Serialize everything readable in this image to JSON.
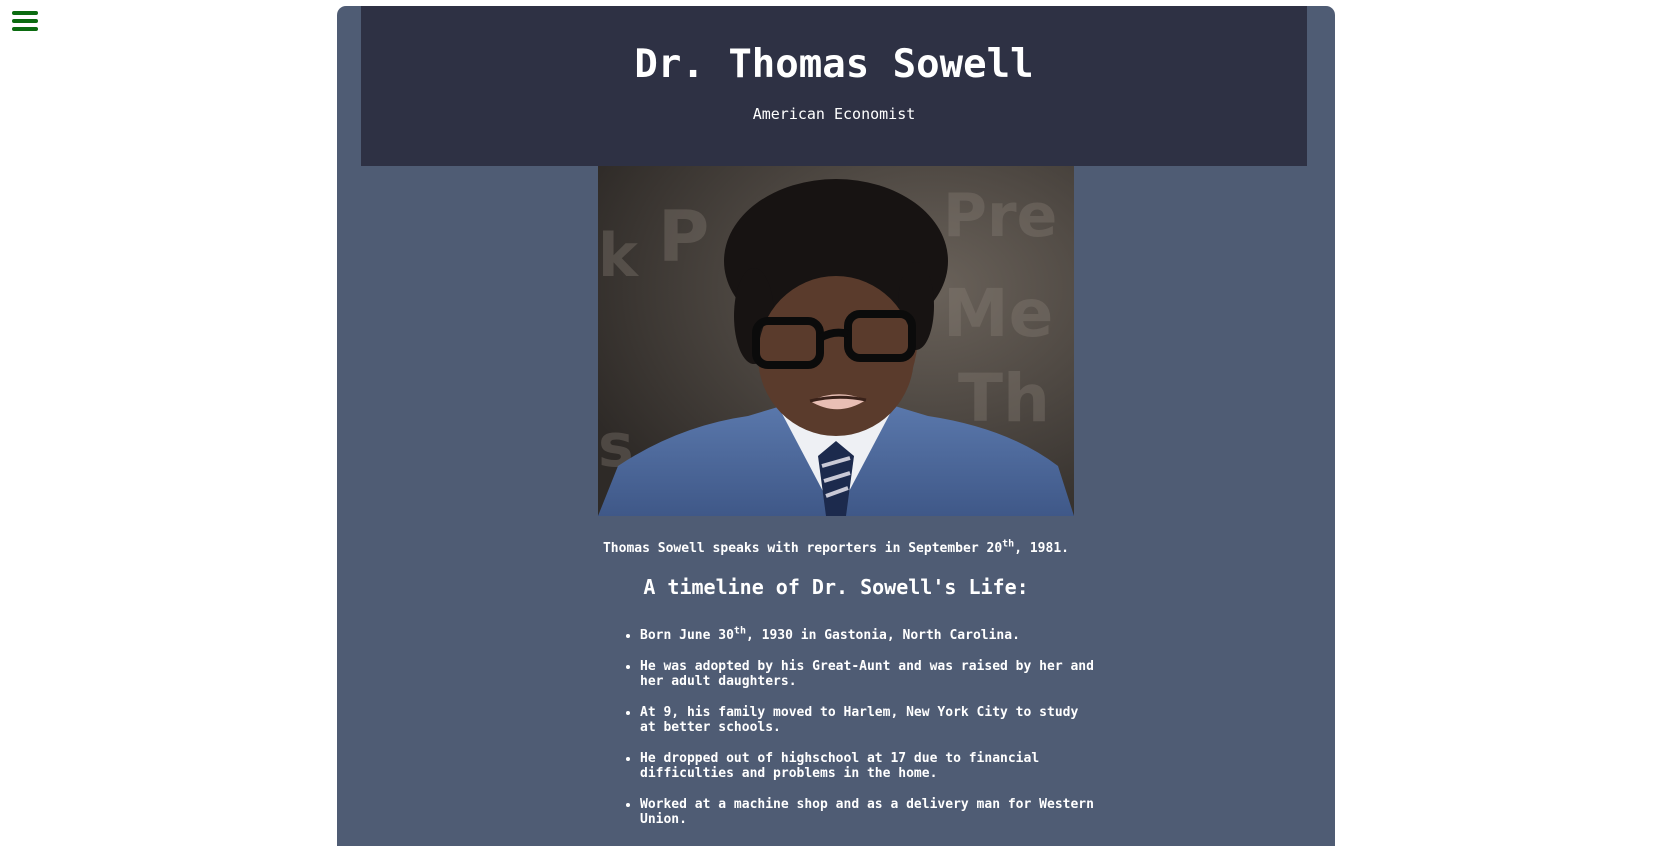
{
  "nav": {
    "menu_icon": "hamburger-menu-icon",
    "accent": "#0b6b10"
  },
  "header": {
    "title": "Dr. Thomas Sowell",
    "subtitle": "American Economist"
  },
  "photo": {
    "alt": "Thomas Sowell portrait"
  },
  "caption": {
    "before": "Thomas Sowell speaks with reporters in September 20",
    "sup": "th",
    "after": ", 1981."
  },
  "timeline": {
    "heading": "A timeline of Dr. Sowell's Life:",
    "items": [
      {
        "before": "Born June 30",
        "sup": "th",
        "after": ", 1930 in Gastonia, North Carolina."
      },
      {
        "text": "He was adopted by his Great-Aunt and was raised by her and her adult daughters."
      },
      {
        "text": "At 9, his family moved to Harlem, New York City to study at better schools."
      },
      {
        "text": "He dropped out of highschool at 17 due to financial difficulties and problems in the home."
      },
      {
        "text": "Worked at a machine shop and as a delivery man for Western Union."
      }
    ]
  },
  "colors": {
    "page": "#ffffff",
    "container": "#4f5c74",
    "header": "#2e3144",
    "text": "#ffffff"
  }
}
